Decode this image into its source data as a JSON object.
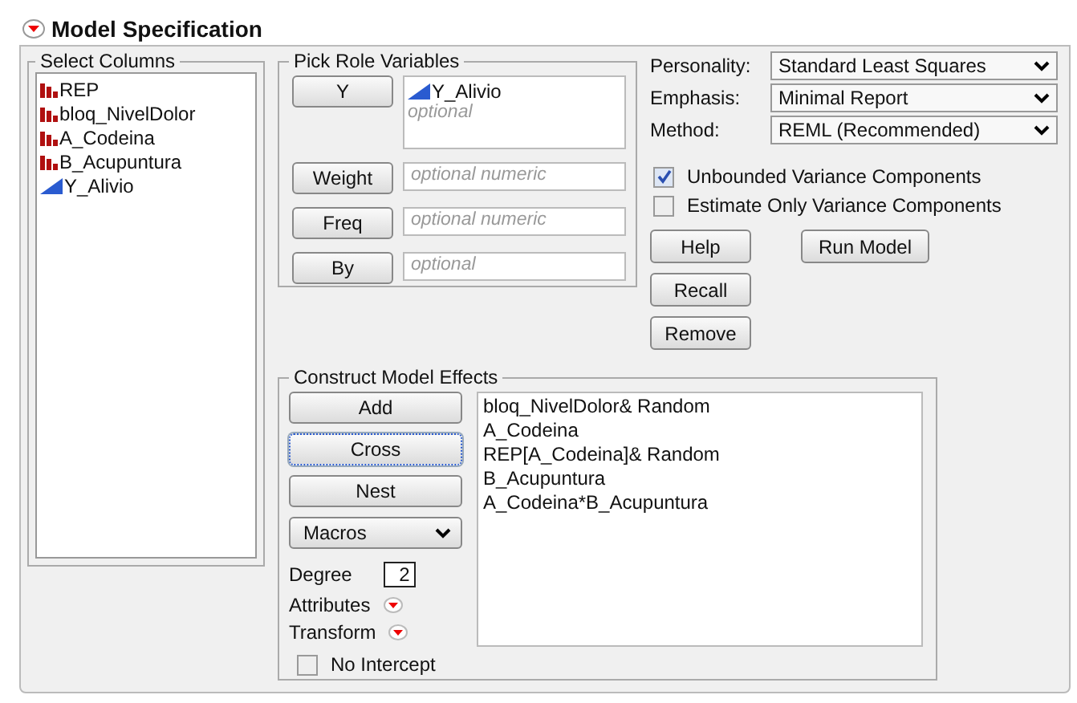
{
  "title": "Model Specification",
  "select_columns": {
    "label": "Select Columns",
    "items": [
      {
        "name": "REP",
        "kind": "nominal"
      },
      {
        "name": "bloq_NivelDolor",
        "kind": "nominal"
      },
      {
        "name": "A_Codeina",
        "kind": "nominal"
      },
      {
        "name": "B_Acupuntura",
        "kind": "nominal"
      },
      {
        "name": "Y_Alivio",
        "kind": "continuous"
      }
    ]
  },
  "pick_role": {
    "label": "Pick Role Variables",
    "roles": [
      {
        "button": "Y",
        "values": [
          {
            "name": "Y_Alivio",
            "kind": "continuous"
          }
        ],
        "placeholder": "optional"
      },
      {
        "button": "Weight",
        "placeholder": "optional numeric"
      },
      {
        "button": "Freq",
        "placeholder": "optional numeric"
      },
      {
        "button": "By",
        "placeholder": "optional"
      }
    ]
  },
  "options": [
    {
      "label": "Personality:",
      "value": "Standard Least Squares"
    },
    {
      "label": "Emphasis:",
      "value": "Minimal Report"
    },
    {
      "label": "Method:",
      "value": "REML (Recommended)"
    }
  ],
  "checkboxes": [
    {
      "label": "Unbounded Variance Components",
      "checked": true
    },
    {
      "label": "Estimate Only Variance Components",
      "checked": false
    }
  ],
  "action_buttons": [
    [
      "Help",
      "Run Model"
    ],
    [
      "Recall"
    ],
    [
      "Remove"
    ]
  ],
  "construct": {
    "label": "Construct Model Effects",
    "buttons": [
      {
        "label": "Add",
        "focused": false
      },
      {
        "label": "Cross",
        "focused": true
      },
      {
        "label": "Nest",
        "focused": false
      }
    ],
    "macros": "Macros",
    "degree_label": "Degree",
    "degree": "2",
    "menus": [
      "Attributes",
      "Transform"
    ],
    "no_intercept": {
      "label": "No Intercept",
      "checked": false
    },
    "effects": [
      "bloq_NivelDolor& Random",
      "A_Codeina",
      "REP[A_Codeina]& Random",
      "B_Acupuntura",
      "A_Codeina*B_Acupuntura"
    ]
  }
}
